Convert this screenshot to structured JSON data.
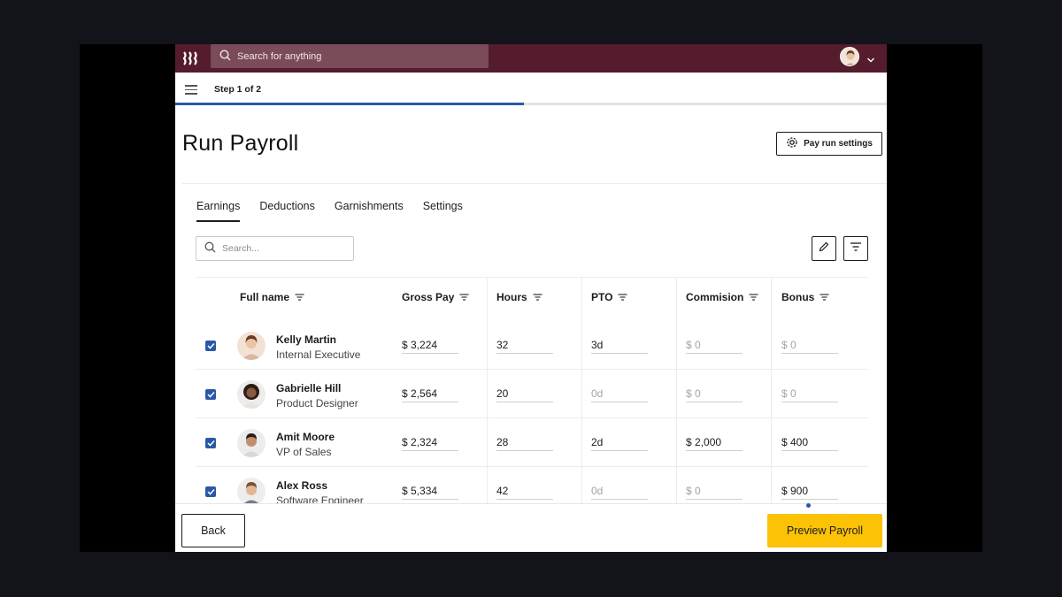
{
  "topbar": {
    "search_placeholder": "Search for anything"
  },
  "stepbar": {
    "step_label": "Step 1 of 2",
    "progress": 0.49
  },
  "header": {
    "title": "Run Payroll",
    "settings_label": "Pay run settings"
  },
  "tabs": [
    {
      "label": "Earnings",
      "active": true
    },
    {
      "label": "Deductions",
      "active": false
    },
    {
      "label": "Garnishments",
      "active": false
    },
    {
      "label": "Settings",
      "active": false
    }
  ],
  "table": {
    "search_placeholder": "Search...",
    "columns": [
      "Full name",
      "Gross Pay",
      "Hours",
      "PTO",
      "Commision",
      "Bonus"
    ],
    "rows": [
      {
        "name": "Kelly Martin",
        "role": "Internal Executive",
        "gross": "$ 3,224",
        "hours": "32",
        "pto": "3d",
        "commission": "$ 0",
        "bonus": "$ 0",
        "checked": true
      },
      {
        "name": "Gabrielle Hill",
        "role": "Product Designer",
        "gross": "$ 2,564",
        "hours": "20",
        "pto": "0d",
        "commission": "$ 0",
        "bonus": "$ 0",
        "checked": true
      },
      {
        "name": "Amit Moore",
        "role": "VP of Sales",
        "gross": "$ 2,324",
        "hours": "28",
        "pto": "2d",
        "commission": "$ 2,000",
        "bonus": "$ 400",
        "checked": true
      },
      {
        "name": "Alex Ross",
        "role": "Software Engineer",
        "gross": "$ 5,334",
        "hours": "42",
        "pto": "0d",
        "commission": "$ 0",
        "bonus": "$ 900",
        "checked": true
      }
    ]
  },
  "footer": {
    "back_label": "Back",
    "preview_label": "Preview Payroll"
  },
  "colors": {
    "topbar": "#541c2c",
    "accent": "#2a58a6",
    "primary_button": "#fbc206"
  }
}
